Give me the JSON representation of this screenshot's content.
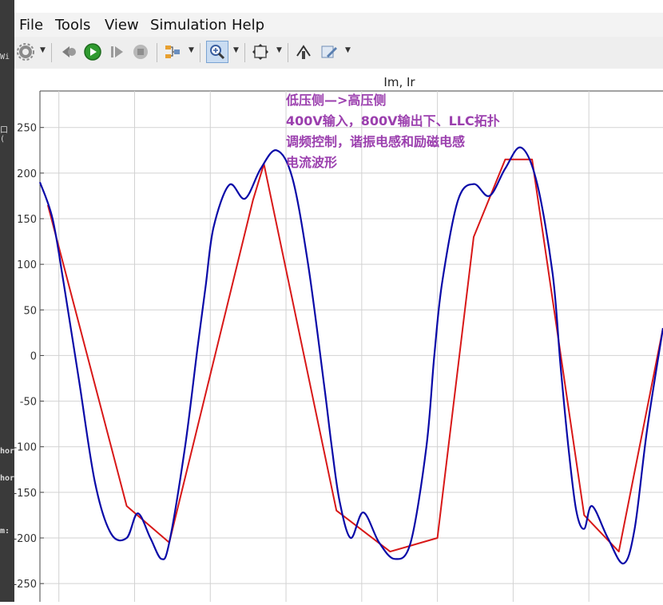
{
  "window": {
    "side_fragments": [
      "Wi",
      "口 (",
      "hor",
      "hor",
      "m:"
    ]
  },
  "menu": {
    "file": "File",
    "tools": "Tools",
    "view": "View",
    "simulation": "Simulation",
    "help": "Help"
  },
  "toolbar": {
    "icons": [
      "gear-icon",
      "step-back-icon",
      "run-icon",
      "step-forward-icon",
      "stop-icon",
      "signal-selector-icon",
      "zoom-icon",
      "fit-to-view-icon",
      "cursor-measure-icon",
      "style-edit-icon"
    ],
    "selected": "zoom-icon"
  },
  "annotation": {
    "line1": "低压侧—>高压侧",
    "line2": "400V输入，800V输出下、LLC拓扑",
    "line3": "调频控制，谐振电感和励磁电感",
    "line4": "电流波形"
  },
  "colors": {
    "ir": "#0a0aa8",
    "im": "#d81818",
    "annotation": "#9b3fae",
    "grid": "#d2d2d2"
  },
  "chart_data": {
    "type": "line",
    "title": "Im, Ir",
    "xlabel": "",
    "ylabel": "",
    "ylim": [
      -270,
      290
    ],
    "yticks": [
      250,
      200,
      150,
      100,
      50,
      0,
      -50,
      -100,
      -150,
      -200,
      -250
    ],
    "xlim": [
      0,
      3.95
    ],
    "grid": true,
    "series": [
      {
        "name": "Ir",
        "color": "#0a0aa8",
        "x": [
          0,
          0.08,
          0.15,
          0.25,
          0.35,
          0.45,
          0.55,
          0.62,
          0.7,
          0.77,
          0.82,
          0.92,
          1.0,
          1.05,
          1.1,
          1.2,
          1.3,
          1.4,
          1.5,
          1.6,
          1.7,
          1.8,
          1.85,
          1.9,
          1.97,
          2.05,
          2.15,
          2.25,
          2.35,
          2.45,
          2.5,
          2.55,
          2.65,
          2.75,
          2.85,
          2.95,
          3.05,
          3.15,
          3.25,
          3.3,
          3.35,
          3.4,
          3.45,
          3.5,
          3.6,
          3.7,
          3.77,
          3.85,
          3.95
        ],
        "y": [
          190,
          150,
          80,
          -30,
          -140,
          -195,
          -200,
          -173,
          -200,
          -223,
          -205,
          -100,
          10,
          75,
          140,
          187,
          172,
          205,
          225,
          195,
          100,
          -30,
          -100,
          -160,
          -200,
          -172,
          -205,
          -223,
          -205,
          -100,
          0,
          80,
          170,
          188,
          175,
          205,
          228,
          190,
          90,
          -10,
          -100,
          -170,
          -190,
          -165,
          -200,
          -228,
          -190,
          -80,
          30
        ]
      },
      {
        "name": "Im",
        "color": "#d81818",
        "x": [
          0.05,
          0.55,
          0.82,
          1.35,
          1.42,
          1.88,
          2.22,
          2.52,
          2.75,
          2.95,
          3.12,
          3.45,
          3.67,
          3.95
        ],
        "y": [
          165,
          -165,
          -205,
          170,
          210,
          -170,
          -215,
          -200,
          130,
          215,
          215,
          -175,
          -215,
          30
        ]
      }
    ]
  }
}
